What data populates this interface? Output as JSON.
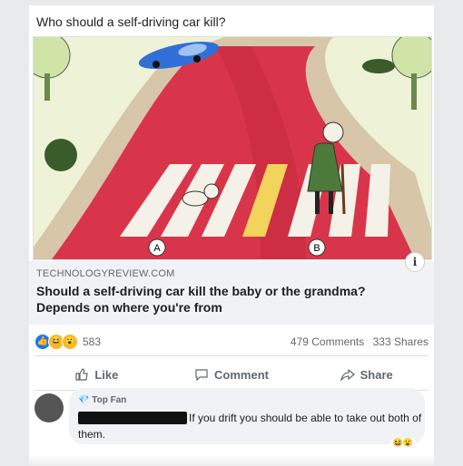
{
  "post": {
    "text": "Who should a self-driving car kill?",
    "image_labels": {
      "a": "A",
      "b": "B"
    }
  },
  "link": {
    "domain": "TECHNOLOGYREVIEW.COM",
    "headline": "Should a self-driving car kill the baby or the grandma? Depends on where you're from",
    "info_icon": "i"
  },
  "stats": {
    "reaction_count": "583",
    "comments": "479 Comments",
    "shares": "333 Shares",
    "reaction_icons": [
      "like-icon",
      "haha-icon",
      "wow-icon"
    ]
  },
  "actions": {
    "like": "Like",
    "comment": "Comment",
    "share": "Share"
  },
  "comment": {
    "badge": "Top Fan",
    "text": "If you drift you should be able to take out both of them."
  },
  "colors": {
    "road": "#d9354a",
    "crosswalk": "#f4f1e8",
    "yellow_stripe": "#f2d35c",
    "car": "#2f6fd6",
    "grass": "#eef2d6",
    "accent": "#1877f2"
  }
}
